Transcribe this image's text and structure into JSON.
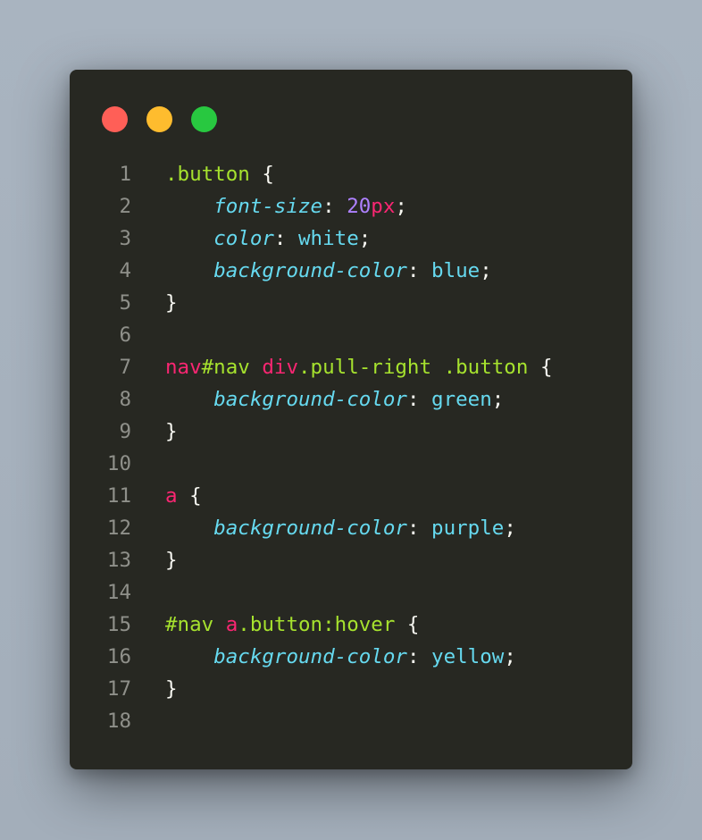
{
  "colors": {
    "background": "#a6b1bd",
    "window": "#272822",
    "line_number": "#8f908a",
    "selector_class": "#a6e22e",
    "selector_tag": "#f92672",
    "property": "#66d9ef",
    "number": "#ae81ff",
    "value": "#f8f8f2",
    "punctuation": "#f8f8f2"
  },
  "window_controls": [
    {
      "name": "close-dot-icon",
      "color": "#ff5f57"
    },
    {
      "name": "minimize-dot-icon",
      "color": "#febc2e"
    },
    {
      "name": "maximize-dot-icon",
      "color": "#28c840"
    }
  ],
  "lines": [
    {
      "num": "1",
      "tokens": [
        {
          "t": ".button",
          "k": "selector_class"
        },
        {
          "t": " {",
          "k": "punctuation"
        }
      ]
    },
    {
      "num": "2",
      "tokens": [
        {
          "t": "    ",
          "k": "punctuation"
        },
        {
          "t": "font-size",
          "k": "property",
          "italic": true
        },
        {
          "t": ": ",
          "k": "punctuation"
        },
        {
          "t": "20",
          "k": "number"
        },
        {
          "t": "px",
          "k": "selector_tag"
        },
        {
          "t": ";",
          "k": "punctuation"
        }
      ]
    },
    {
      "num": "3",
      "tokens": [
        {
          "t": "    ",
          "k": "punctuation"
        },
        {
          "t": "color",
          "k": "property",
          "italic": true
        },
        {
          "t": ": ",
          "k": "punctuation"
        },
        {
          "t": "white",
          "k": "property"
        },
        {
          "t": ";",
          "k": "punctuation"
        }
      ]
    },
    {
      "num": "4",
      "tokens": [
        {
          "t": "    ",
          "k": "punctuation"
        },
        {
          "t": "background-color",
          "k": "property",
          "italic": true
        },
        {
          "t": ": ",
          "k": "punctuation"
        },
        {
          "t": "blue",
          "k": "property"
        },
        {
          "t": ";",
          "k": "punctuation"
        }
      ]
    },
    {
      "num": "5",
      "tokens": [
        {
          "t": "}",
          "k": "punctuation"
        }
      ]
    },
    {
      "num": "6",
      "tokens": []
    },
    {
      "num": "7",
      "tokens": [
        {
          "t": "nav",
          "k": "selector_tag"
        },
        {
          "t": "#nav",
          "k": "selector_class"
        },
        {
          "t": " ",
          "k": "punctuation"
        },
        {
          "t": "div",
          "k": "selector_tag"
        },
        {
          "t": ".pull-right .button",
          "k": "selector_class"
        },
        {
          "t": " {",
          "k": "punctuation"
        }
      ]
    },
    {
      "num": "8",
      "tokens": [
        {
          "t": "    ",
          "k": "punctuation"
        },
        {
          "t": "background-color",
          "k": "property",
          "italic": true
        },
        {
          "t": ": ",
          "k": "punctuation"
        },
        {
          "t": "green",
          "k": "property"
        },
        {
          "t": ";",
          "k": "punctuation"
        }
      ]
    },
    {
      "num": "9",
      "tokens": [
        {
          "t": "}",
          "k": "punctuation"
        }
      ]
    },
    {
      "num": "10",
      "tokens": []
    },
    {
      "num": "11",
      "tokens": [
        {
          "t": "a",
          "k": "selector_tag"
        },
        {
          "t": " {",
          "k": "punctuation"
        }
      ]
    },
    {
      "num": "12",
      "tokens": [
        {
          "t": "    ",
          "k": "punctuation"
        },
        {
          "t": "background-color",
          "k": "property",
          "italic": true
        },
        {
          "t": ": ",
          "k": "punctuation"
        },
        {
          "t": "purple",
          "k": "property"
        },
        {
          "t": ";",
          "k": "punctuation"
        }
      ]
    },
    {
      "num": "13",
      "tokens": [
        {
          "t": "}",
          "k": "punctuation"
        }
      ]
    },
    {
      "num": "14",
      "tokens": []
    },
    {
      "num": "15",
      "tokens": [
        {
          "t": "#nav",
          "k": "selector_class"
        },
        {
          "t": " ",
          "k": "punctuation"
        },
        {
          "t": "a",
          "k": "selector_tag"
        },
        {
          "t": ".button:hover",
          "k": "selector_class"
        },
        {
          "t": " {",
          "k": "punctuation"
        }
      ]
    },
    {
      "num": "16",
      "tokens": [
        {
          "t": "    ",
          "k": "punctuation"
        },
        {
          "t": "background-color",
          "k": "property",
          "italic": true
        },
        {
          "t": ": ",
          "k": "punctuation"
        },
        {
          "t": "yellow",
          "k": "property"
        },
        {
          "t": ";",
          "k": "punctuation"
        }
      ]
    },
    {
      "num": "17",
      "tokens": [
        {
          "t": "}",
          "k": "punctuation"
        }
      ]
    },
    {
      "num": "18",
      "tokens": []
    }
  ]
}
